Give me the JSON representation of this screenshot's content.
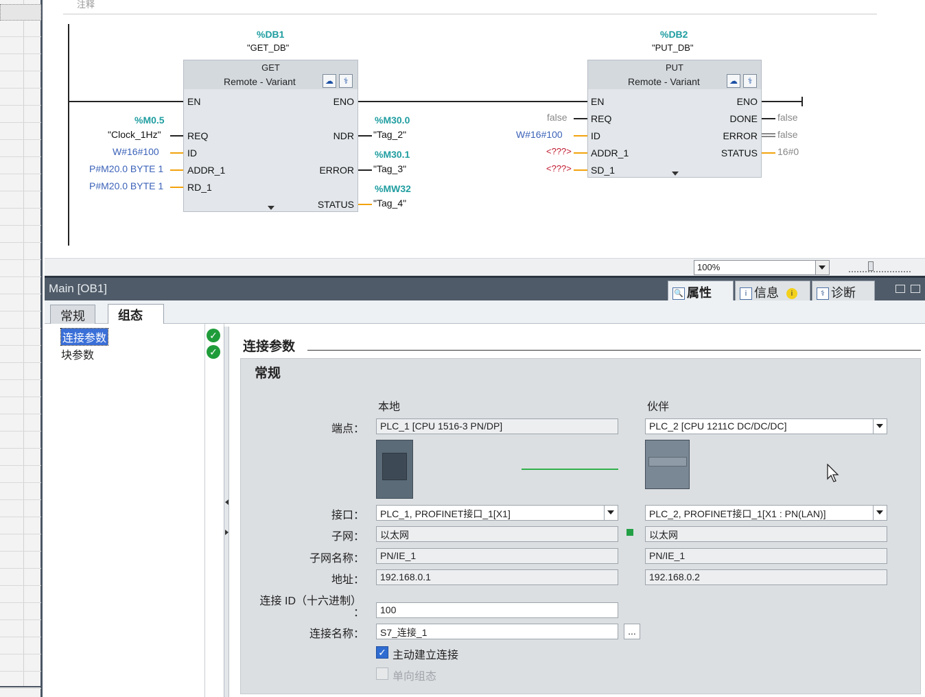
{
  "editor": {
    "comment_label": "注释",
    "get_block": {
      "db_address": "%DB1",
      "db_name": "\"GET_DB\"",
      "title": "GET",
      "subtitle": "Remote - Variant",
      "pins_in": [
        "EN",
        "REQ",
        "ID",
        "ADDR_1",
        "RD_1"
      ],
      "pins_out": [
        "ENO",
        "NDR",
        "ERROR",
        "STATUS"
      ],
      "req_addr": "%M0.5",
      "req_tag": "\"Clock_1Hz\"",
      "id_value": "W#16#100",
      "addr1_value": "P#M20.0 BYTE 1",
      "rd1_value": "P#M20.0 BYTE 1",
      "ndr_addr": "%M30.0",
      "ndr_tag": "\"Tag_2\"",
      "error_addr": "%M30.1",
      "error_tag": "\"Tag_3\"",
      "status_addr": "%MW32",
      "status_tag": "\"Tag_4\""
    },
    "put_block": {
      "db_address": "%DB2",
      "db_name": "\"PUT_DB\"",
      "title": "PUT",
      "subtitle": "Remote - Variant",
      "pins_in": [
        "EN",
        "REQ",
        "ID",
        "ADDR_1",
        "SD_1"
      ],
      "pins_out": [
        "ENO",
        "DONE",
        "ERROR",
        "STATUS"
      ],
      "req_value": "false",
      "id_value": "W#16#100",
      "addr1_value": "<???>",
      "sd1_value": "<???>",
      "done_value": "false",
      "error_value": "false",
      "status_value": "16#0"
    },
    "zoom": "100%"
  },
  "inspector": {
    "title": "Main [OB1]",
    "tabs": [
      "属性",
      "信息",
      "诊断"
    ],
    "active_tab": "属性",
    "subtabs": [
      "常规",
      "组态"
    ],
    "active_subtab": "组态",
    "nav_items": [
      "连接参数",
      "块参数"
    ]
  },
  "connection": {
    "section_title": "连接参数",
    "panel_title": "常规",
    "local_header": "本地",
    "partner_header": "伙伴",
    "labels": {
      "endpoint": "端点：",
      "interface": "接口：",
      "subnet": "子网：",
      "subnet_name": "子网名称：",
      "address": "地址：",
      "conn_id": "连接 ID（十六进制）",
      "conn_id_colon": "：",
      "conn_name": "连接名称："
    },
    "local": {
      "endpoint": "PLC_1 [CPU 1516-3 PN/DP]",
      "interface": "PLC_1, PROFINET接口_1[X1]",
      "subnet": "以太网",
      "subnet_name": "PN/IE_1",
      "address": "192.168.0.1"
    },
    "partner": {
      "endpoint": "PLC_2 [CPU 1211C DC/DC/DC]",
      "interface": "PLC_2, PROFINET接口_1[X1 : PN(LAN)]",
      "subnet": "以太网",
      "subnet_name": "PN/IE_1",
      "address": "192.168.0.2"
    },
    "conn_id": "100",
    "conn_name": "S7_连接_1",
    "browse_label": "...",
    "active_connect_label": "主动建立连接",
    "active_connect_checked": true,
    "one_way_label": "单向组态",
    "one_way_checked": false
  }
}
